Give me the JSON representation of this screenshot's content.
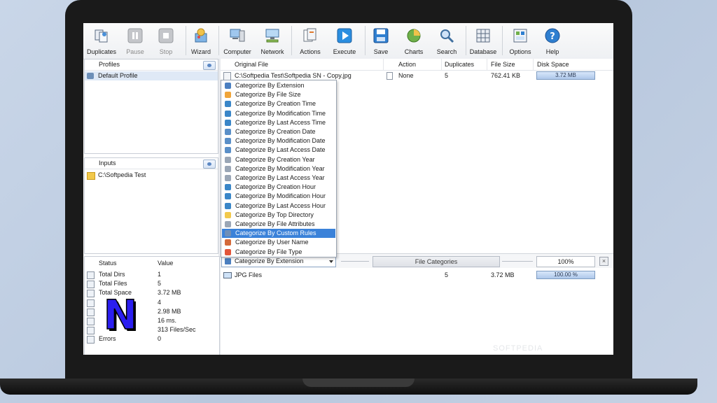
{
  "toolbar": {
    "items": [
      {
        "label": "Duplicates",
        "icon": "duplicates-icon"
      },
      {
        "label": "Pause",
        "icon": "pause-icon"
      },
      {
        "label": "Stop",
        "icon": "stop-icon"
      },
      {
        "label": "Wizard",
        "icon": "wizard-icon"
      },
      {
        "label": "Computer",
        "icon": "computer-icon"
      },
      {
        "label": "Network",
        "icon": "network-icon"
      },
      {
        "label": "Actions",
        "icon": "actions-icon"
      },
      {
        "label": "Execute",
        "icon": "execute-icon"
      },
      {
        "label": "Save",
        "icon": "save-icon"
      },
      {
        "label": "Charts",
        "icon": "charts-icon"
      },
      {
        "label": "Search",
        "icon": "search-icon"
      },
      {
        "label": "Database",
        "icon": "database-icon"
      },
      {
        "label": "Options",
        "icon": "options-icon"
      },
      {
        "label": "Help",
        "icon": "help-icon"
      }
    ]
  },
  "profiles": {
    "header": "Profiles",
    "items": [
      "Default Profile"
    ]
  },
  "inputs": {
    "header": "Inputs",
    "items": [
      "C:\\Softpedia Test"
    ]
  },
  "results": {
    "headers": {
      "original_file": "Original File",
      "action": "Action",
      "duplicates": "Duplicates",
      "file_size": "File Size",
      "disk_space": "Disk Space"
    },
    "rows": [
      {
        "file": "C:\\Softpedia Test\\Softpedia SN - Copy.jpg",
        "action": "None",
        "duplicates": "5",
        "file_size": "762.41 KB",
        "disk_space": "3.72 MB"
      }
    ]
  },
  "categorize_menu": {
    "items": [
      "Categorize By Extension",
      "Categorize By File Size",
      "Categorize By Creation Time",
      "Categorize By Modification Time",
      "Categorize By Last Access Time",
      "Categorize By Creation Date",
      "Categorize By Modification Date",
      "Categorize By Last Access Date",
      "Categorize By Creation Year",
      "Categorize By Modification Year",
      "Categorize By Last Access Year",
      "Categorize By Creation Hour",
      "Categorize By Modification Hour",
      "Categorize By Last Access Hour",
      "Categorize By Top Directory",
      "Categorize By File Attributes",
      "Categorize By Custom Rules",
      "Categorize By User Name",
      "Categorize By File Type"
    ],
    "selected_index": 16
  },
  "category_bar": {
    "selected": "Categorize By Extension",
    "file_categories_label": "File Categories",
    "percent": "100%",
    "close_glyph": "×"
  },
  "categories": {
    "rows": [
      {
        "name": "JPG Files",
        "count": "5",
        "size": "3.72 MB",
        "percent": "100.00 %"
      }
    ]
  },
  "status": {
    "headers": {
      "status": "Status",
      "value": "Value"
    },
    "rows": [
      {
        "name": "Total Dirs",
        "value": "1"
      },
      {
        "name": "Total Files",
        "value": "5"
      },
      {
        "name": "Total Space",
        "value": "3.72 MB"
      },
      {
        "name": "",
        "value": "4"
      },
      {
        "name": "",
        "value": "2.98 MB"
      },
      {
        "name": "",
        "value": "16 ms."
      },
      {
        "name": "",
        "value": "313 Files/Sec"
      },
      {
        "name": "Errors",
        "value": "0"
      }
    ]
  },
  "watermark": "SOFTPEDIA",
  "logo_letter": "N",
  "colors": {
    "selection": "#3b82d9",
    "bar_fill": "#aec7ea",
    "logo": "#2b1ef0"
  }
}
